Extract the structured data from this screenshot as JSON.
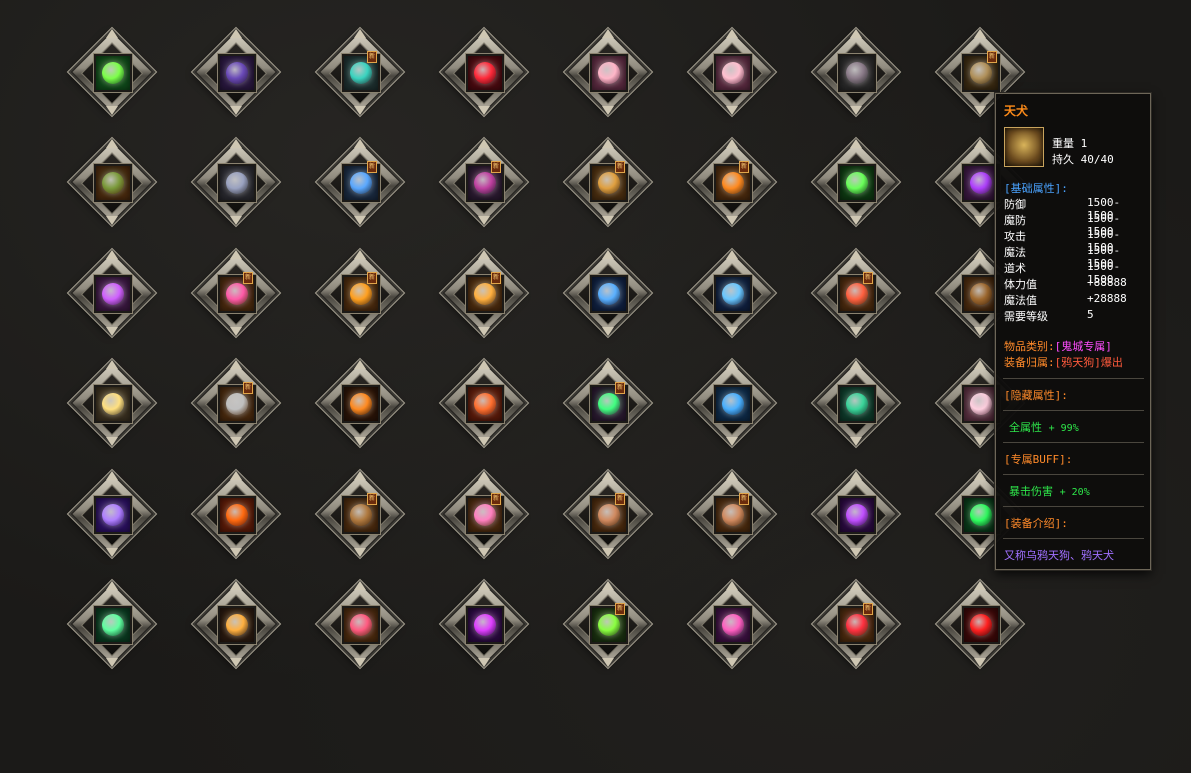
{
  "slots": [
    {
      "bg": "#0f4a1a",
      "glyph": "#7dff4a",
      "badge": false
    },
    {
      "bg": "#2a1840",
      "glyph": "#6a4ab8",
      "badge": false
    },
    {
      "bg": "#1e3030",
      "glyph": "#3ad4c0",
      "badge": true
    },
    {
      "bg": "#4a0a10",
      "glyph": "#ff2a3a",
      "badge": false
    },
    {
      "bg": "#5a2a40",
      "glyph": "#ffb6c8",
      "badge": false
    },
    {
      "bg": "#5a2a40",
      "glyph": "#ffc0d0",
      "badge": false
    },
    {
      "bg": "#2a2a2a",
      "glyph": "#8a7a88",
      "badge": false
    },
    {
      "bg": "#3a2a12",
      "glyph": "#b0905a",
      "badge": true
    },
    {
      "bg": "#4a2a0e",
      "glyph": "#7a9a3a",
      "badge": false
    },
    {
      "bg": "#2a2a30",
      "glyph": "#9aa2c0",
      "badge": false
    },
    {
      "bg": "#1a2a40",
      "glyph": "#5aa8ff",
      "badge": true
    },
    {
      "bg": "#2a1a30",
      "glyph": "#c040a0",
      "badge": true
    },
    {
      "bg": "#4a2e10",
      "glyph": "#e0a040",
      "badge": true
    },
    {
      "bg": "#4a2a0e",
      "glyph": "#ff8a20",
      "badge": true
    },
    {
      "bg": "#0e3a12",
      "glyph": "#6aff5a",
      "badge": false
    },
    {
      "bg": "#3a1840",
      "glyph": "#b040ff",
      "badge": false
    },
    {
      "bg": "#3a1840",
      "glyph": "#d060ff",
      "badge": false
    },
    {
      "bg": "#4a2a0e",
      "glyph": "#ff5aa8",
      "badge": true
    },
    {
      "bg": "#4a2a0e",
      "glyph": "#ffa020",
      "badge": true
    },
    {
      "bg": "#4a2a0e",
      "glyph": "#ffb040",
      "badge": true
    },
    {
      "bg": "#102040",
      "glyph": "#5ab0ff",
      "badge": false
    },
    {
      "bg": "#102040",
      "glyph": "#6ac8ff",
      "badge": false
    },
    {
      "bg": "#4a2a0e",
      "glyph": "#ff6040",
      "badge": true
    },
    {
      "bg": "#4a2a0e",
      "glyph": "#a06a30",
      "badge": false
    },
    {
      "bg": "#3a3020",
      "glyph": "#ffe080",
      "badge": false
    },
    {
      "bg": "#4a2a0e",
      "glyph": "#c0c0c0",
      "badge": true
    },
    {
      "bg": "#2a1408",
      "glyph": "#ff8a20",
      "badge": false
    },
    {
      "bg": "#5a1a0a",
      "glyph": "#ff7030",
      "badge": false
    },
    {
      "bg": "#2a1a30",
      "glyph": "#40ff80",
      "badge": true
    },
    {
      "bg": "#0e2a48",
      "glyph": "#4ab0ff",
      "badge": false
    },
    {
      "bg": "#0e3a2a",
      "glyph": "#3ad49a",
      "badge": false
    },
    {
      "bg": "#5a3040",
      "glyph": "#ffd0e0",
      "badge": false
    },
    {
      "bg": "#2a1060",
      "glyph": "#b080ff",
      "badge": false
    },
    {
      "bg": "#5a1a08",
      "glyph": "#ff6a10",
      "badge": false
    },
    {
      "bg": "#4a2a0e",
      "glyph": "#b07a40",
      "badge": true
    },
    {
      "bg": "#4a2a0e",
      "glyph": "#ff80c0",
      "badge": true
    },
    {
      "bg": "#4a2a0e",
      "glyph": "#d08a60",
      "badge": true
    },
    {
      "bg": "#4a2a0e",
      "glyph": "#d08a60",
      "badge": true
    },
    {
      "bg": "#2a0a40",
      "glyph": "#c050ff",
      "badge": false
    },
    {
      "bg": "#0a3a1a",
      "glyph": "#30ff60",
      "badge": false
    },
    {
      "bg": "#0a3a20",
      "glyph": "#60ffa0",
      "badge": false
    },
    {
      "bg": "#2a1a10",
      "glyph": "#ffb040",
      "badge": false
    },
    {
      "bg": "#4a2a0e",
      "glyph": "#ff5a80",
      "badge": false
    },
    {
      "bg": "#2a0a40",
      "glyph": "#e040ff",
      "badge": false
    },
    {
      "bg": "#1a3010",
      "glyph": "#8aff40",
      "badge": true
    },
    {
      "bg": "#3a1040",
      "glyph": "#ff60c0",
      "badge": false
    },
    {
      "bg": "#4a2a0e",
      "glyph": "#ff3040",
      "badge": true
    },
    {
      "bg": "#3a0808",
      "glyph": "#ff2020",
      "badge": false
    }
  ],
  "badge_text": "新",
  "tooltip": {
    "title": "天犬",
    "weight": "重量 1",
    "durability": "持久 40/40",
    "base_header": "[基础属性]:",
    "stats": [
      {
        "key": "防御",
        "value": "1500-1500"
      },
      {
        "key": "魔防",
        "value": "1500-1500"
      },
      {
        "key": "攻击",
        "value": "1500-1500"
      },
      {
        "key": "魔法",
        "value": "1500-1500"
      },
      {
        "key": "道术",
        "value": "1500-1500"
      },
      {
        "key": "体力值",
        "value": "+88888"
      },
      {
        "key": "魔法值",
        "value": "+28888"
      },
      {
        "key": "需要等级",
        "value": "5"
      }
    ],
    "category_label": "物品类别:",
    "category_value": "[鬼城专属]",
    "owner_label": "装备归属:",
    "owner_value": "[鸦天狗]爆出",
    "hidden_header": "[隐藏属性]:",
    "hidden_attr": "全属性",
    "hidden_value": "+ 99%",
    "buff_header": "[专属BUFF]:",
    "buff_attr": "暴击伤害",
    "buff_value": "+ 20%",
    "intro_header": "[装备介绍]:",
    "intro_text": "又称乌鸦天狗、鸦天犬"
  }
}
